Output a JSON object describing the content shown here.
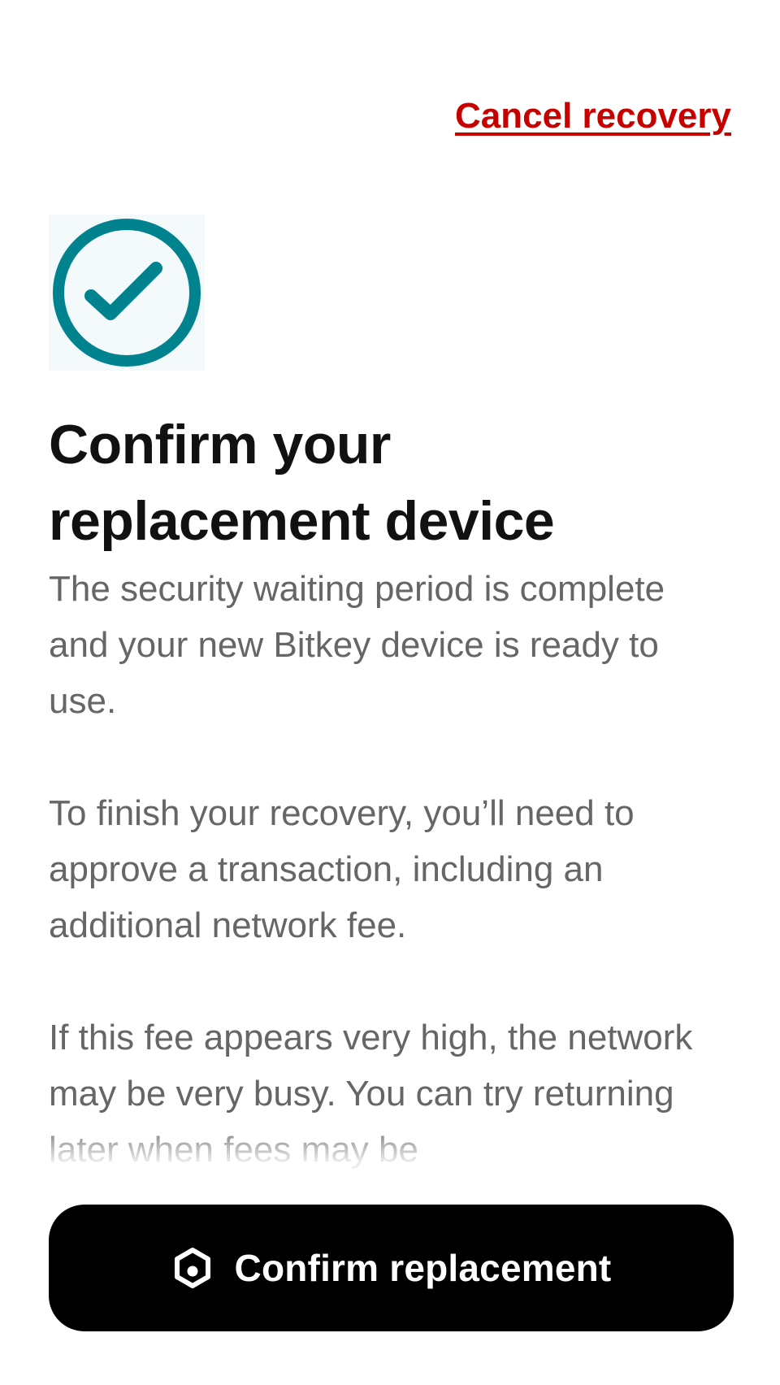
{
  "header": {
    "cancel_label": "Cancel recovery"
  },
  "hero": {
    "icon": "check-circle-icon",
    "icon_color": "#00838f"
  },
  "main": {
    "title_line1": "Confirm your",
    "title_line2": "replacement device",
    "paragraphs": [
      "The security waiting period is complete and your new Bitkey device is ready to use.",
      "To finish your recovery, you’ll need to approve a transaction, including an additional network fee.",
      "If this fee appears very high, the network may be very busy. You can try returning later when fees may be"
    ]
  },
  "footer": {
    "button_label": "Confirm replacement",
    "button_icon": "bitkey-device-icon"
  },
  "colors": {
    "cancel": "#c70000",
    "button_bg": "#000000",
    "title": "#111111",
    "body": "#666666"
  }
}
